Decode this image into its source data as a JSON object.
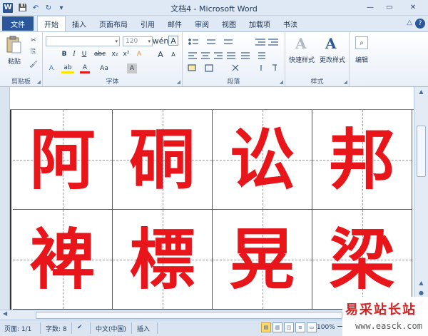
{
  "window": {
    "title": "文档4 - Microsoft Word",
    "app_icon": "W",
    "qat": {
      "save_icon": "💾",
      "undo_icon": "↶",
      "redo_icon": "↻",
      "customize_icon": "▾"
    },
    "controls": {
      "minimize": "—",
      "maximize": "▭",
      "close": "✕"
    }
  },
  "tabs": {
    "file": "文件",
    "items": [
      "开始",
      "插入",
      "页面布局",
      "引用",
      "邮件",
      "审阅",
      "视图",
      "加载项",
      "书法"
    ],
    "active_index": 0,
    "right": {
      "collapse": "△",
      "help": "?"
    }
  },
  "ribbon": {
    "clipboard": {
      "label": "剪贴板",
      "paste": "粘贴",
      "cut": "✂",
      "copy": "⎘",
      "format_painter": "🖌"
    },
    "font": {
      "label": "字体",
      "font_name": "",
      "font_size": "120",
      "grow": "A",
      "shrink": "A",
      "bold": "B",
      "italic": "I",
      "underline": "U",
      "strike": "abc",
      "sub": "x₂",
      "sup": "x²",
      "phonetic": "wén",
      "clear": "A",
      "text_effects": "A",
      "highlight": "ab",
      "font_color": "A",
      "change_case": "Aa",
      "char_shading": "A",
      "char_border": "A"
    },
    "paragraph": {
      "label": "段落"
    },
    "styles": {
      "label": "样式",
      "quick": "快速样式",
      "change": "更改样式"
    },
    "editing": {
      "label": "编辑"
    }
  },
  "document": {
    "characters": [
      "阿",
      "硐",
      "讼",
      "邦",
      "裨",
      "標",
      "晃",
      "梁"
    ],
    "char_color": "#e8161b"
  },
  "statusbar": {
    "page": "页面: 1/1",
    "words": "字数: 8",
    "language": "中文(中国)",
    "insert": "插入",
    "zoom": "100%",
    "zoom_out": "−"
  },
  "watermark": {
    "title": "易采站长站",
    "url": "www.easck.com"
  }
}
